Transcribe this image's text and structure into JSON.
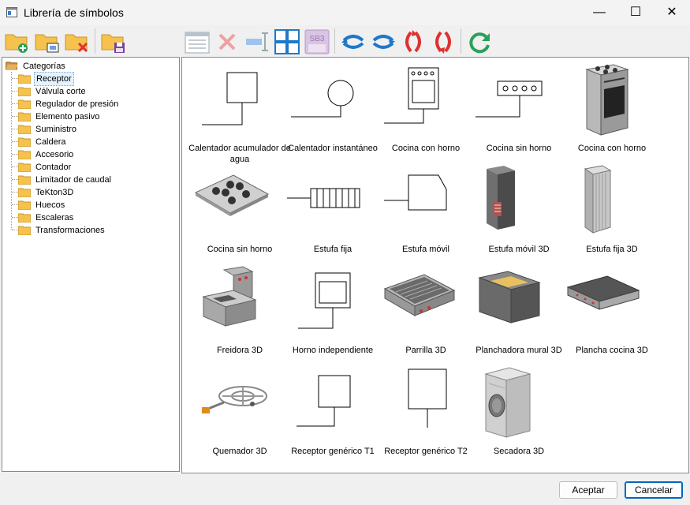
{
  "window": {
    "title": "Librería de símbolos"
  },
  "window_controls": {
    "minimize": "—",
    "maximize": "☐",
    "close": "✕"
  },
  "toolbar": {
    "buttons": [
      "folder-add-icon",
      "folder-properties-icon",
      "folder-delete-icon",
      "folder-save-icon",
      "symbol-properties-icon",
      "delete-icon",
      "dimension-icon",
      "grid-view-icon",
      "sb3-icon",
      "rotate-left-icon",
      "rotate-right-icon",
      "rotate-up-icon",
      "rotate-down-icon",
      "refresh-icon"
    ],
    "sb3_label": "SB3"
  },
  "tree": {
    "root": "Categorías",
    "items": [
      "Receptor",
      "Válvula corte",
      "Regulador de presión",
      "Elemento pasivo",
      "Suministro",
      "Caldera",
      "Accesorio",
      "Contador",
      "Limitador de caudal",
      "TeKton3D",
      "Huecos",
      "Escaleras",
      "Transformaciones"
    ],
    "selected": "Receptor"
  },
  "symbols": [
    {
      "label": "Calentador acumulador de agua"
    },
    {
      "label": "Calentador instantáneo"
    },
    {
      "label": "Cocina con horno"
    },
    {
      "label": "Cocina sin horno"
    },
    {
      "label": "Cocina con horno"
    },
    {
      "label": "Cocina sin horno"
    },
    {
      "label": "Estufa fija"
    },
    {
      "label": "Estufa móvil"
    },
    {
      "label": "Estufa móvil 3D"
    },
    {
      "label": "Estufa fija 3D"
    },
    {
      "label": "Freidora 3D"
    },
    {
      "label": "Horno independiente"
    },
    {
      "label": "Parrilla 3D"
    },
    {
      "label": "Planchadora mural 3D"
    },
    {
      "label": "Plancha cocina 3D"
    },
    {
      "label": "Quemador 3D"
    },
    {
      "label": "Receptor genérico T1"
    },
    {
      "label": "Receptor genérico T2"
    },
    {
      "label": "Secadora 3D"
    }
  ],
  "footer": {
    "accept": "Aceptar",
    "cancel": "Cancelar"
  },
  "colors": {
    "folder": "#f5c24d",
    "accent": "#0067c0",
    "red": "#e03030",
    "blue": "#1e78c8",
    "green": "#2aa05a"
  }
}
